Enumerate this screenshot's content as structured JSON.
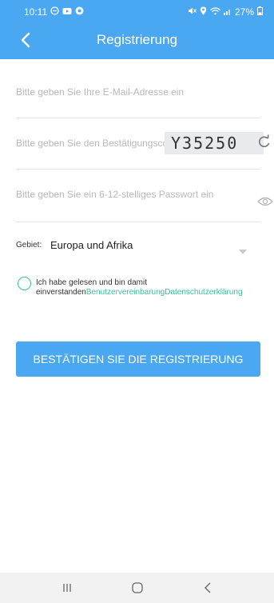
{
  "status_bar": {
    "time": "10:11",
    "battery": "27%"
  },
  "header": {
    "title": "Registrierung",
    "color": "#4aa7f2"
  },
  "form": {
    "email_placeholder": "Bitte geben Sie Ihre E-Mail-Adresse ein",
    "code_placeholder": "Bitte geben Sie den Bestätigungscode ein",
    "captcha_text": "Y35250",
    "password_placeholder": "Bitte geben Sie ein 6-12-stelliges Passwort ein",
    "region_label": "Gebiet:",
    "region_value": "Europa und Afrika"
  },
  "agreement": {
    "line1": "Ich habe gelesen und bin damit",
    "line2_prefix": "einverstanden",
    "link_user": "Benutzervereinbarung",
    "link_privacy": "Datenschutzerklärung",
    "link_color": "#34c399"
  },
  "submit": {
    "label": "BESTÄTIGEN SIE DIE REGISTRIERUNG"
  }
}
